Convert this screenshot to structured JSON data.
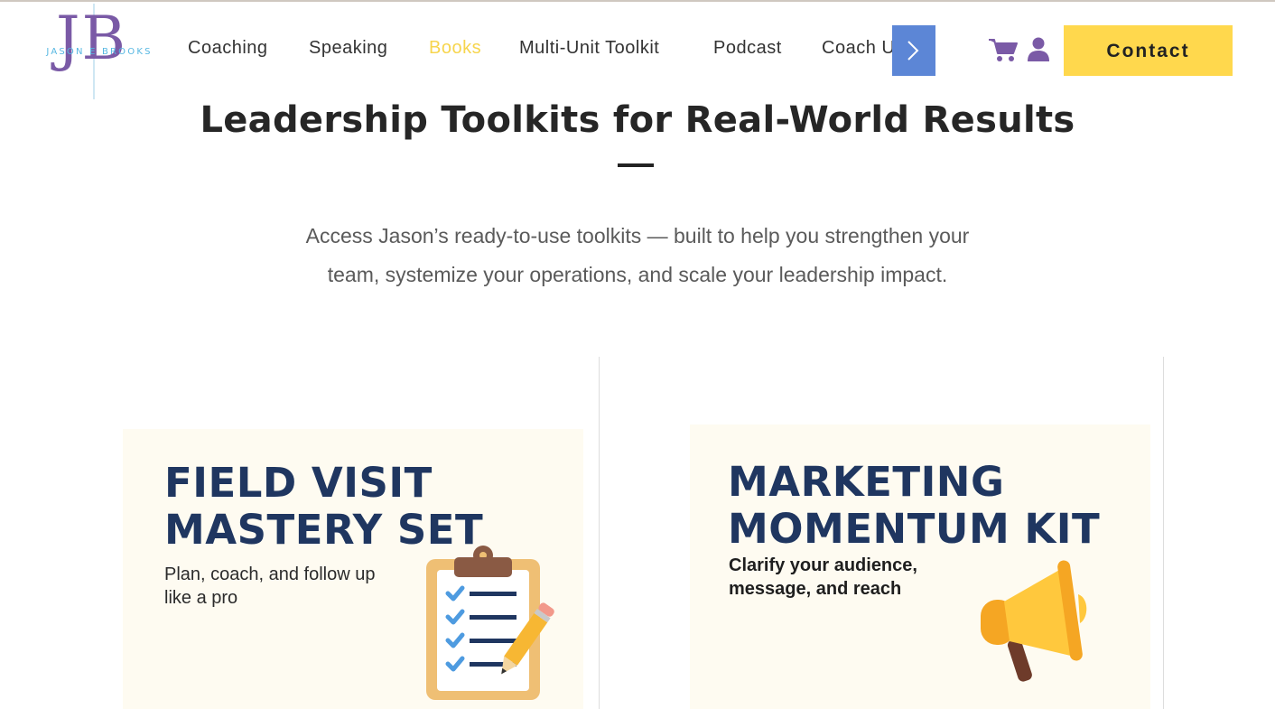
{
  "header": {
    "logo": {
      "initials": "JB",
      "name": "JASON E BROOKS"
    },
    "nav": [
      {
        "label": "Coaching",
        "active": false
      },
      {
        "label": "Speaking",
        "active": false
      },
      {
        "label": "Books",
        "active": true
      },
      {
        "label": "Multi-Unit Toolkit",
        "active": false
      },
      {
        "label": "Podcast",
        "active": false
      },
      {
        "label": "Coach Up",
        "active": false
      }
    ],
    "icons": [
      "chevron-right-icon",
      "cart-icon",
      "user-icon"
    ],
    "contact_label": "Contact"
  },
  "hero": {
    "title": "Leadership Toolkits for Real-World Results",
    "subtitle_line1": "Access Jason’s ready-to-use toolkits — built to help you strengthen your",
    "subtitle_line2": "team, systemize your operations, and scale your leadership impact."
  },
  "cards": [
    {
      "title_line1": "FIELD VISIT",
      "title_line2": "MASTERY SET",
      "desc_line1": "Plan, coach, and follow up",
      "desc_line2": "like a pro",
      "illustration": "clipboard-checklist-icon"
    },
    {
      "title_line1": "MARKETING",
      "title_line2": "MOMENTUM KIT",
      "desc_line1": "Clarify your audience,",
      "desc_line2": "message, and reach",
      "illustration": "megaphone-icon"
    }
  ],
  "colors": {
    "accent_yellow": "#ffd84d",
    "active_nav": "#f7d54d",
    "brand_purple": "#7a5aa6",
    "brand_blue": "#56b7e2",
    "scroll_button": "#5c86d6",
    "card_title": "#1f3660"
  }
}
